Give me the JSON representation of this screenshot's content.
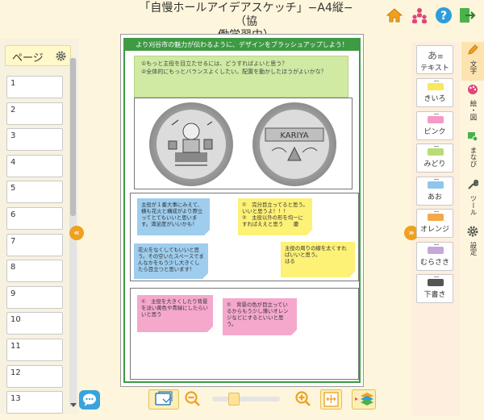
{
  "header": {
    "title_line1": "「自慢ホールアイデアスケッチ」−A4縦−（協",
    "title_line2": "働学習中）",
    "icons": [
      "home-icon",
      "users-icon",
      "help-icon",
      "exit-icon"
    ]
  },
  "sidebar": {
    "title": "ページ",
    "pages": [
      "1",
      "2",
      "3",
      "4",
      "5",
      "6",
      "7",
      "8",
      "9",
      "10",
      "11",
      "12",
      "13"
    ]
  },
  "canvas": {
    "banner": "より刈谷市の魅力が伝わるように、デザインをブラッシュアップしよう！",
    "questions": [
      "①もっと主役を目立たせるには、どうすればよいと思う？",
      "②全体的にもっとバランスよくしたい。配置を動かしたほうがよいかな？"
    ],
    "notes_middle": [
      "主役が１番大事にみえて、横も花火と構成がより際立ってとてもいいと思います。満足度がいいかも！",
      "①　完分目立ってると思う。いいと思うよ！！！\n②　主役以外の形を均一にすればええと思う　　慶",
      "花火をなくしてもいいと思う。その空いたスペースでまんなかをもう少し大きくしたら目立つと思います！",
      "主役の周りの線を太くすればいいと思う。\nはる"
    ],
    "notes_bottom": [
      "①　主役を大きくしたり背景を淡い黄色や青緑にしたらいいと思う",
      "①　背景の色が目立っているからもう少し薄いオレンジなどにするといいと思う。"
    ]
  },
  "colors": [
    {
      "label": "テキスト",
      "color": "#ffffff"
    },
    {
      "label": "きいろ",
      "color": "#f7e95a"
    },
    {
      "label": "ピンク",
      "color": "#f49ac6"
    },
    {
      "label": "みどり",
      "color": "#b8dd74"
    },
    {
      "label": "あお",
      "color": "#8fc6ea"
    },
    {
      "label": "オレンジ",
      "color": "#f4a84a"
    },
    {
      "label": "むらさき",
      "color": "#c7a6dc"
    },
    {
      "label": "下書き",
      "color": "#555555"
    }
  ],
  "side_tabs": [
    "文字",
    "絵・図",
    "まなび",
    "ツール",
    "設定"
  ],
  "theme": {
    "accent": "#f0a020",
    "banner_green": "#3e9a43"
  }
}
